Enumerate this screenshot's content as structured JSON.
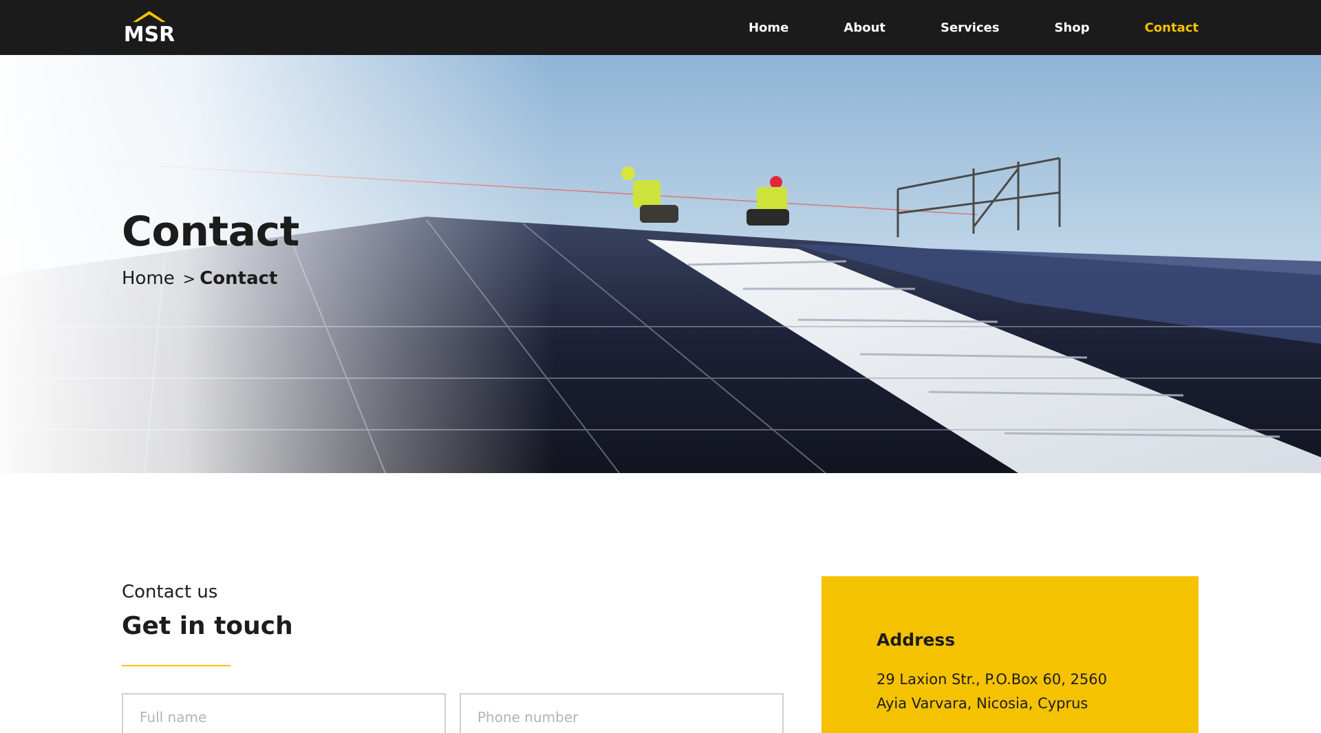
{
  "header": {
    "logo_text": "MSR",
    "nav": [
      {
        "label": "Home"
      },
      {
        "label": "About"
      },
      {
        "label": "Services"
      },
      {
        "label": "Shop"
      },
      {
        "label": "Contact",
        "active": true
      }
    ]
  },
  "hero": {
    "title": "Contact",
    "breadcrumb": {
      "home": "Home",
      "separator": ">",
      "current": "Contact"
    }
  },
  "contact_section": {
    "eyebrow": "Contact us",
    "title": "Get in touch",
    "fields": {
      "full_name_placeholder": "Full name",
      "phone_placeholder": "Phone number"
    }
  },
  "info_card": {
    "heading": "Address",
    "address_line1": "29 Laxion Str., P.O.Box 60, 2560",
    "address_line2": "Ayia Varvara, Nicosia, Cyprus"
  },
  "colors": {
    "accent": "#f5c200",
    "header_bg": "#1b1b1b",
    "text": "#1c1c1c"
  }
}
